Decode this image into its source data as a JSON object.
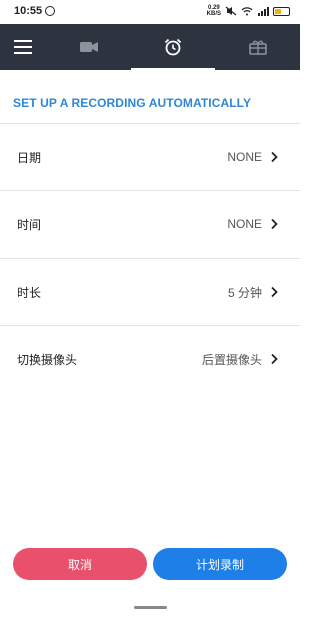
{
  "status": {
    "time": "10:55",
    "net_speed_value": "0.29",
    "net_speed_unit": "KB/S"
  },
  "tabs": [
    {
      "icon": "menu-icon"
    },
    {
      "icon": "video-camera-icon"
    },
    {
      "icon": "alarm-clock-icon",
      "active": true
    },
    {
      "icon": "gift-box-icon"
    }
  ],
  "section": {
    "title": "SET UP A RECORDING AUTOMATICALLY"
  },
  "rows": [
    {
      "label": "日期",
      "value": "NONE"
    },
    {
      "label": "时间",
      "value": "NONE"
    },
    {
      "label": "时长",
      "value": "5 分钟"
    },
    {
      "label": "切换摄像头",
      "value": "后置摄像头"
    }
  ],
  "buttons": {
    "cancel": "取消",
    "schedule": "计划录制"
  },
  "colors": {
    "tabbar": "#2d3440",
    "accent": "#2f86d6",
    "cancel": "#e9506b",
    "schedule": "#1f7fe8"
  }
}
